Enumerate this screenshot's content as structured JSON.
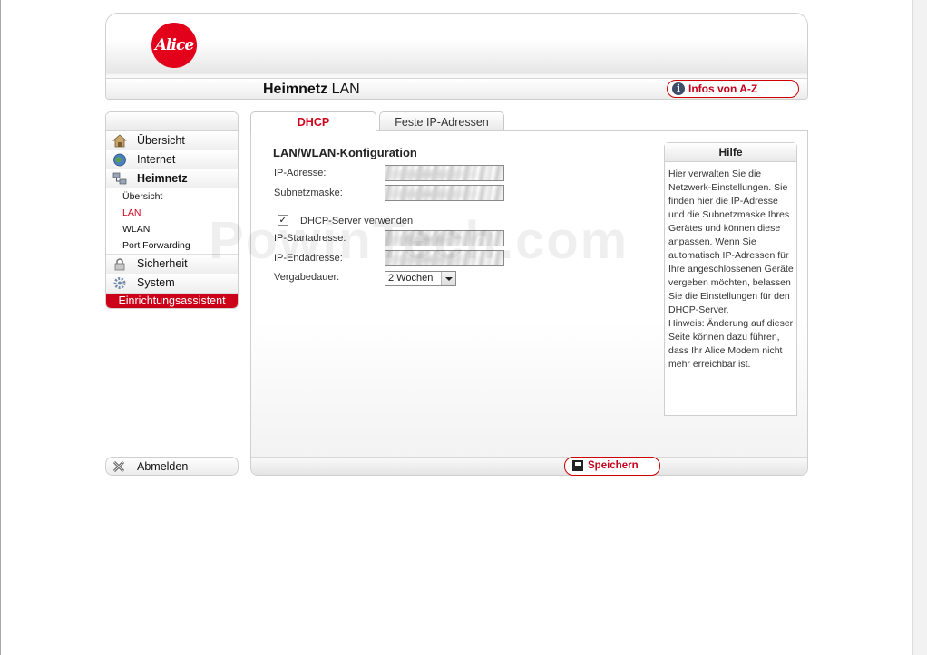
{
  "header": {
    "logo_text": "Alice",
    "title_bold": "Heimnetz",
    "title_rest": " LAN",
    "infos_button": "Infos von A-Z"
  },
  "sidebar": {
    "items": [
      {
        "label": "Übersicht",
        "icon": "house-icon"
      },
      {
        "label": "Internet",
        "icon": "globe-icon"
      },
      {
        "label": "Heimnetz",
        "icon": "network-icon"
      }
    ],
    "subitems": [
      {
        "label": "Übersicht"
      },
      {
        "label": "LAN"
      },
      {
        "label": "WLAN"
      },
      {
        "label": "Port Forwarding"
      }
    ],
    "items_bottom": [
      {
        "label": "Sicherheit",
        "icon": "lock-icon"
      },
      {
        "label": "System",
        "icon": "gear-icon"
      }
    ],
    "wizard": "Einrichtungsassistent",
    "logout": "Abmelden"
  },
  "tabs": [
    {
      "label": "DHCP"
    },
    {
      "label": "Feste IP-Adressen"
    }
  ],
  "form": {
    "section_title": "LAN/WLAN-Konfiguration",
    "ip_label": "IP-Adresse:",
    "subnet_label": "Subnetzmaske:",
    "dhcp_checkbox_label": "DHCP-Server verwenden",
    "dhcp_checked": true,
    "start_label": "IP-Startadresse:",
    "end_label": "IP-Endadresse:",
    "lease_label": "Vergabedauer:",
    "lease_value": "2 Wochen"
  },
  "help": {
    "title": "Hilfe",
    "text": "Hier verwalten Sie die Netzwerk-Einstellungen. Sie finden hier die IP-Adresse und die Subnetzmaske Ihres Gerätes und können diese anpassen. Wenn Sie automatisch IP-Adressen für Ihre angeschlossenen Geräte vergeben möchten, belassen Sie die Einstellungen für den DHCP-Server.",
    "note": "Hinweis: Änderung auf dieser Seite können dazu führen, dass Ihr Alice Modem nicht mehr erreichbar ist."
  },
  "footer": {
    "save_button": "Speichern"
  },
  "watermark": "PowinTech.com",
  "colors": {
    "brand_red": "#e2001a",
    "active_red": "#d0021b"
  }
}
